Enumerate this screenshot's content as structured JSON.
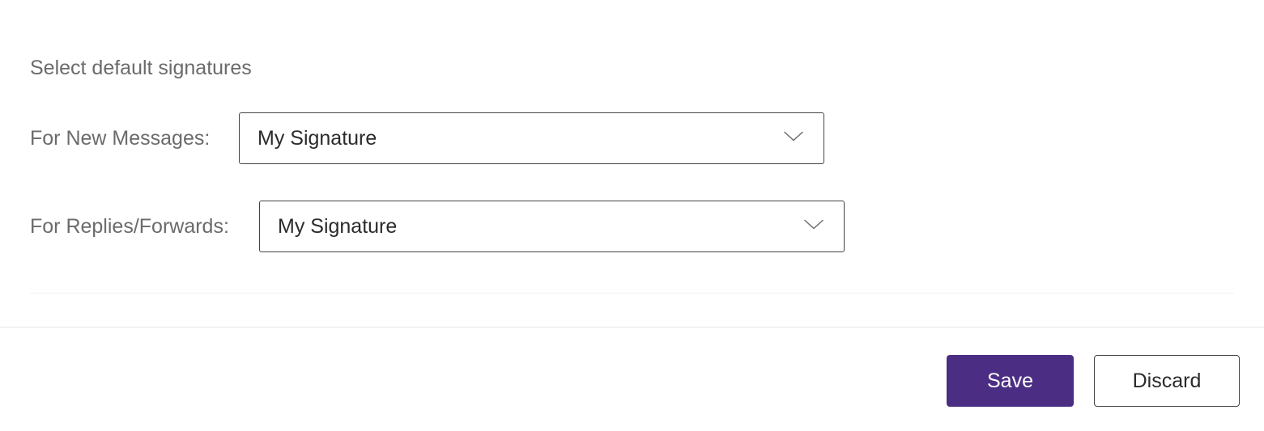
{
  "section": {
    "title": "Select default signatures"
  },
  "form": {
    "newMessages": {
      "label": "For New Messages:",
      "selected": "My Signature"
    },
    "repliesForwards": {
      "label": "For Replies/Forwards:",
      "selected": "My Signature"
    }
  },
  "footer": {
    "save": "Save",
    "discard": "Discard"
  }
}
